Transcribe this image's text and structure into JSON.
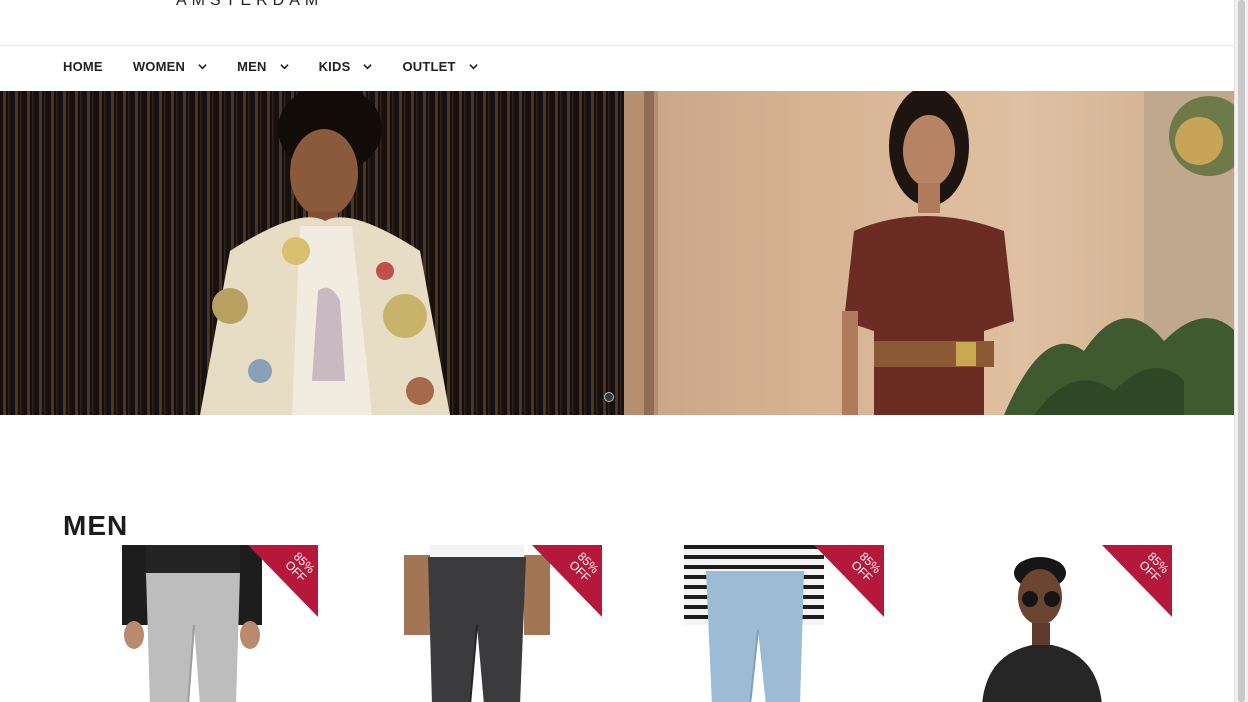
{
  "brand": {
    "wordmark": "AMSTERDAM"
  },
  "nav": {
    "items": [
      {
        "label": "HOME",
        "has_dropdown": false
      },
      {
        "label": "WOMEN",
        "has_dropdown": true
      },
      {
        "label": "MEN",
        "has_dropdown": true
      },
      {
        "label": "KIDS",
        "has_dropdown": true
      },
      {
        "label": "OUTLET",
        "has_dropdown": true
      }
    ],
    "chevron_icon": "chevron-down-icon"
  },
  "hero": {
    "slides": 2,
    "active_slide": 1,
    "left_image": "man-in-floral-jacket",
    "right_image": "woman-in-patterned-dress"
  },
  "section": {
    "title": "MEN"
  },
  "products": [
    {
      "badge_pct": "85%",
      "badge_off": "OFF",
      "image": "grey-jeans"
    },
    {
      "badge_pct": "85%",
      "badge_off": "OFF",
      "image": "black-jeans"
    },
    {
      "badge_pct": "85%",
      "badge_off": "OFF",
      "image": "light-blue-jeans"
    },
    {
      "badge_pct": "85%",
      "badge_off": "OFF",
      "image": "man-with-sunglasses"
    }
  ],
  "colors": {
    "badge": "#b5183b",
    "text": "#1c1c1c"
  }
}
